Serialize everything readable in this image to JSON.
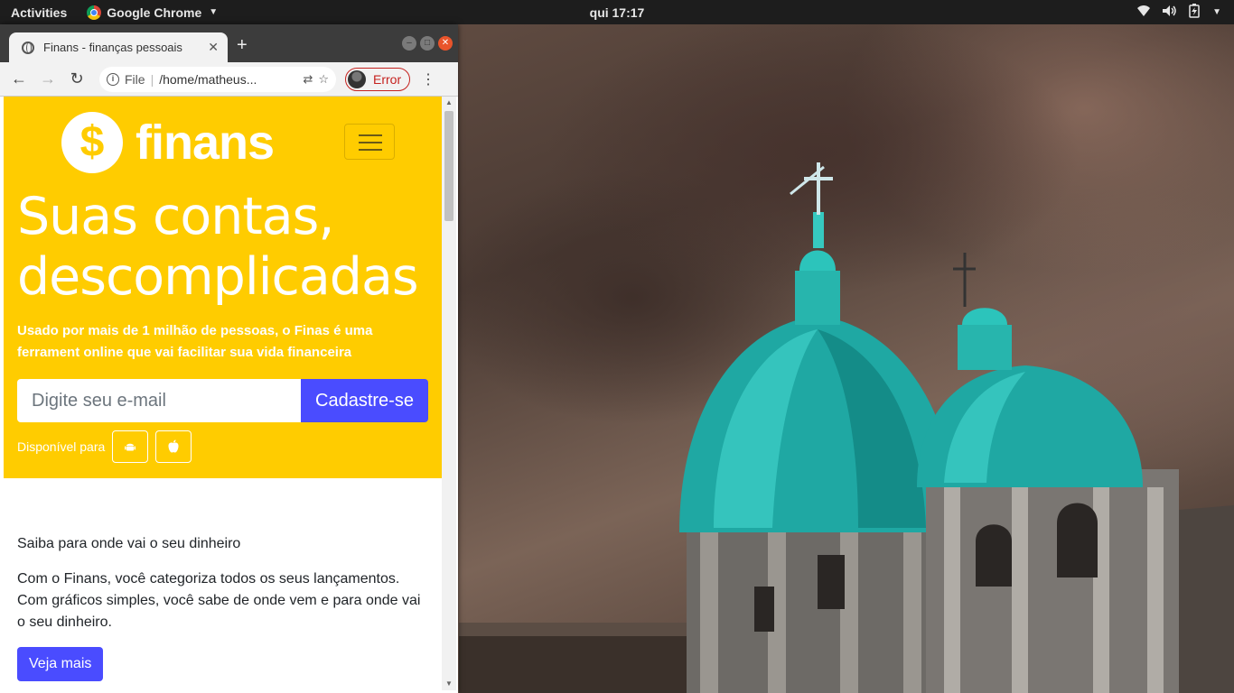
{
  "topbar": {
    "activities": "Activities",
    "app_name": "Google Chrome",
    "clock": "qui 17:17"
  },
  "browser": {
    "tab_title": "Finans - finanças pessoais",
    "omnibox": {
      "scheme_label": "File",
      "url": "/home/matheus..."
    },
    "profile_label": "Error"
  },
  "page": {
    "brand": "finans",
    "brand_symbol": "$",
    "headline": "Suas contas, descomplicadas",
    "subheadline": "Usado por mais de 1 milhão de pessoas, o Finas é uma ferrament online que vai facilitar sua vida financeira",
    "email_placeholder": "Digite seu e-mail",
    "signup_button": "Cadastre-se",
    "available_label": "Disponível para",
    "section_lead": "Saiba para onde vai o seu dinheiro",
    "section_text": "Com o Finans, você categoriza todos os seus lançamentos. Com gráficos simples, você sabe de onde vem e para onde vai o seu dinheiro.",
    "more_button": "Veja mais"
  },
  "colors": {
    "hero_yellow": "#ffcc00",
    "button_blue": "#4a4cff",
    "error_red": "#c5221f"
  },
  "icons": [
    "chrome-icon",
    "globe-icon",
    "info-icon",
    "translate-icon",
    "star-icon",
    "android-icon",
    "apple-icon",
    "wifi-icon",
    "volume-icon",
    "battery-icon"
  ]
}
